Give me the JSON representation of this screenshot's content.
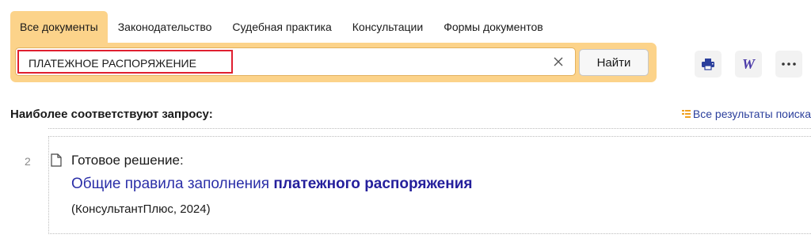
{
  "tabs": [
    {
      "label": "Все документы",
      "active": true
    },
    {
      "label": "Законодательство",
      "active": false
    },
    {
      "label": "Судебная практика",
      "active": false
    },
    {
      "label": "Консультации",
      "active": false
    },
    {
      "label": "Формы документов",
      "active": false
    }
  ],
  "search": {
    "value": "ПЛАТЕЖНОЕ РАСПОРЯЖЕНИЕ",
    "clear_icon": "close-icon",
    "find_label": "Найти"
  },
  "toolbar": {
    "print_icon": "printer-icon",
    "word_icon": "word-export-icon",
    "word_glyph": "W",
    "more_icon": "more-dots-icon"
  },
  "results": {
    "heading": "Наиболее соответствуют запросу:",
    "all_results_label": "Все результаты поиска",
    "items": [
      {
        "number": "2",
        "type": "Готовое решение:",
        "title_plain": "Общие правила заполнения ",
        "title_bold": "платежного распоряжения",
        "source": "(КонсультантПлюс, 2024)"
      }
    ]
  },
  "colors": {
    "accent": "#fcd38a",
    "highlight_border": "#e01f2f",
    "link": "#2b2fa8"
  }
}
